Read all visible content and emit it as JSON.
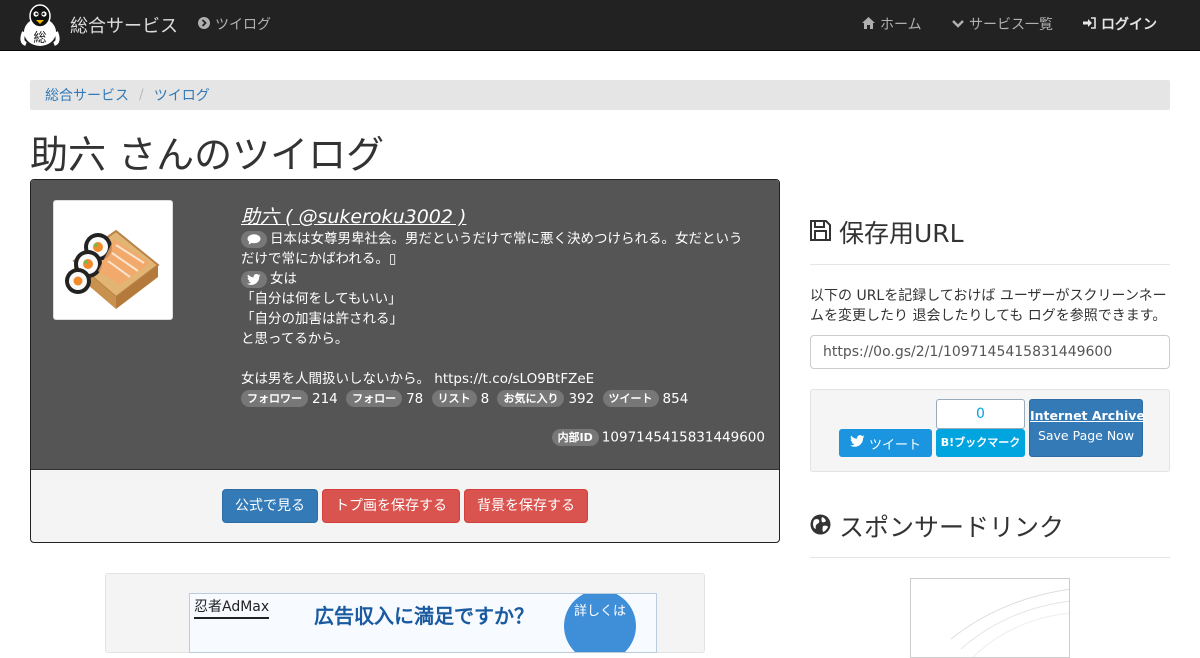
{
  "navbar": {
    "brand": "総合サービス",
    "tweetlog_link": "ツイログ",
    "home": "ホーム",
    "services": "サービス一覧",
    "login": "ログイン"
  },
  "breadcrumb": {
    "home": "総合サービス",
    "current": "ツイログ"
  },
  "page_title": "助六 さんのツイログ",
  "profile": {
    "name_line": "助六 ( @sukeroku3002 )",
    "bio_lines": [
      "日本は女尊男卑社会。男だというだけで常に悪く決めつけられる。女だという",
      "だけで常にかばわれる。▯",
      "女は",
      "「自分は何をしてもいい」",
      "「自分の加害は許される」",
      "と思ってるから。",
      "",
      "女は男を人間扱いしないから。 https://t.co/sLO9BtFZeE"
    ],
    "stats": [
      {
        "label": "フォロワー",
        "value": "214"
      },
      {
        "label": "フォロー",
        "value": "78"
      },
      {
        "label": "リスト",
        "value": "8"
      },
      {
        "label": "お気に入り",
        "value": "392"
      },
      {
        "label": "ツイート",
        "value": "854"
      }
    ],
    "internal_id_label": "内部ID",
    "internal_id": "1097145415831449600",
    "buttons": {
      "official": "公式で見る",
      "save_icon": "トプ画を保存する",
      "save_bg": "背景を保存する"
    }
  },
  "ad": {
    "logo": "忍者AdMax",
    "headline": "広告収入に満足ですか？",
    "circle": "詳しくは"
  },
  "save_url": {
    "title": "保存用URL",
    "description": "以下の URLを記録しておけば ユーザーがスクリーンネームを変更したり 退会したりしても ログを参照できます。",
    "url": "https://0o.gs/2/1/1097145415831449600"
  },
  "share": {
    "tweet": "ツイート",
    "hatena_count": "0",
    "hatena_label": "B!ブックマーク",
    "ia_line1": "Internet Archive",
    "ia_line2": "Save Page Now"
  },
  "sponsor": {
    "title": "スポンサードリンク"
  },
  "colors": {
    "navbar": "#222222",
    "profile_bg": "#555555",
    "primary": "#337ab7",
    "danger": "#d9534f",
    "twitter": "#1b95e0",
    "hatena": "#00a4de"
  }
}
